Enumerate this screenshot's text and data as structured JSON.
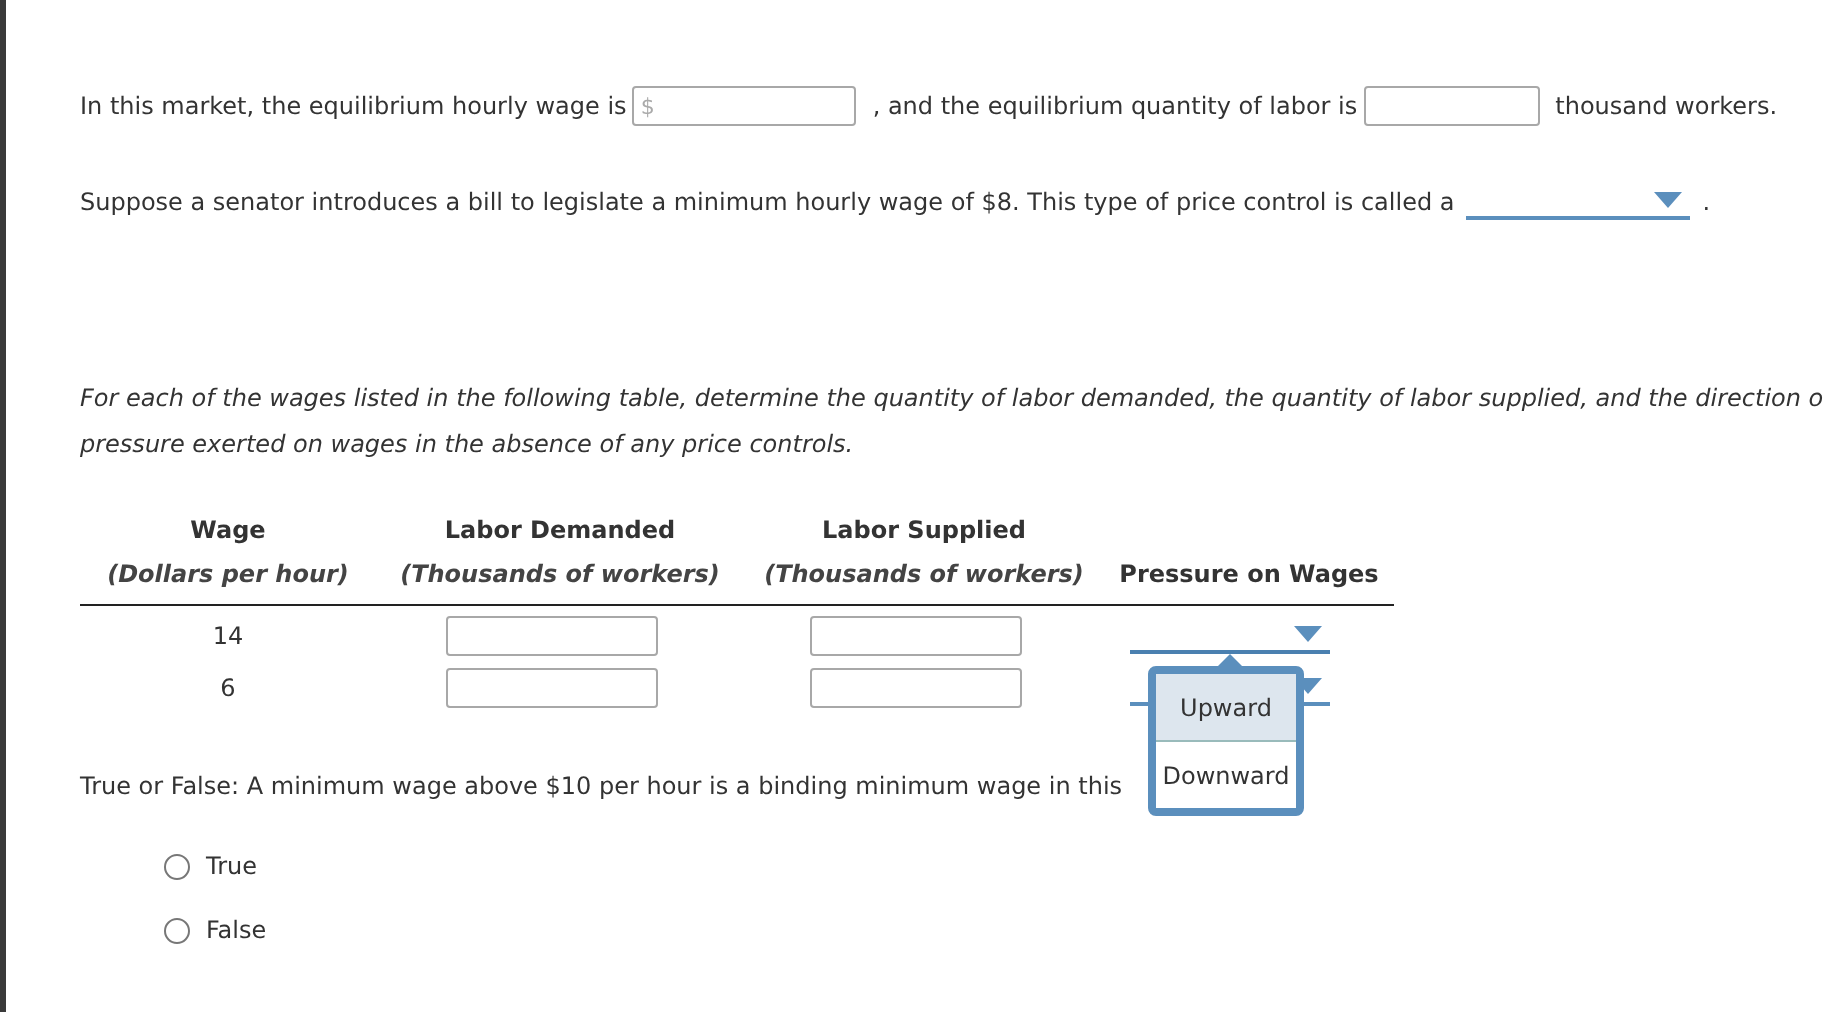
{
  "sentences": [
    {
      "parts": [
        {
          "kind": "text",
          "text": "In this market, the equilibrium hourly wage is"
        },
        {
          "kind": "input",
          "placeholder": "$"
        },
        {
          "kind": "text",
          "text": ", and the equilibrium quantity of labor is"
        },
        {
          "kind": "input"
        },
        {
          "kind": "text",
          "text": "thousand workers."
        }
      ]
    },
    {
      "parts": [
        {
          "kind": "text",
          "text": "Suppose a senator introduces a bill to legislate a minimum hourly wage of $8. This type of price control is called a"
        },
        {
          "kind": "dropdown"
        },
        {
          "kind": "text",
          "text": "."
        }
      ]
    }
  ],
  "instructions": [
    "For each of the wages listed in the following table, determine the quantity of labor demanded, the quantity of labor supplied, and the direction o",
    "pressure exerted on wages in the absence of any price controls."
  ],
  "table": {
    "columns": [
      {
        "title": "Wage",
        "subtitle": "(Dollars per hour)"
      },
      {
        "title": "Labor Demanded",
        "subtitle": "(Thousands of workers)"
      },
      {
        "title": "Labor Supplied",
        "subtitle": "(Thousands of workers)"
      },
      {
        "title": "Pressure on Wages"
      }
    ],
    "rows": [
      {
        "wage": "14",
        "expanded": true,
        "options": [
          {
            "label": "Upward",
            "highlighted": true
          },
          {
            "label": "Downward",
            "highlighted": false
          }
        ]
      },
      {
        "wage": "6",
        "expanded": false
      }
    ]
  },
  "question": "True or False: A minimum wage above $10 per hour is a binding minimum wage in this",
  "choices": [
    {
      "label": "True",
      "selected": false
    },
    {
      "label": "False",
      "selected": false
    }
  ]
}
